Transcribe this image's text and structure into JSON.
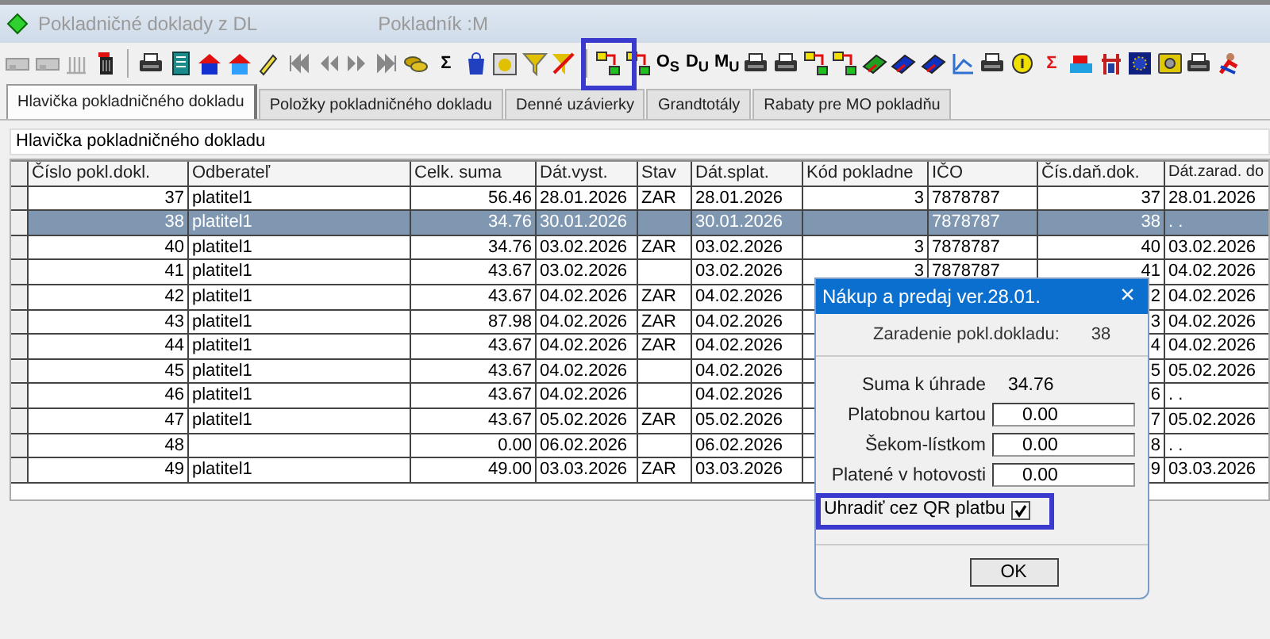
{
  "window": {
    "title": "Pokladničné doklady z DL",
    "cashier": "Pokladník :M"
  },
  "toolbar": [
    {
      "kind": "icon"
    },
    {
      "kind": "icon"
    },
    {
      "kind": "icon"
    },
    {
      "kind": "icon"
    },
    {
      "kind": "separator"
    },
    {
      "kind": "icon"
    },
    {
      "kind": "icon"
    },
    {
      "kind": "icon"
    },
    {
      "kind": "icon"
    },
    {
      "kind": "icon"
    },
    {
      "kind": "icon"
    },
    {
      "kind": "icon"
    },
    {
      "kind": "icon"
    },
    {
      "kind": "icon"
    },
    {
      "kind": "icon"
    },
    {
      "kind": "glyph",
      "text": "Σ",
      "color": "#000000"
    },
    {
      "kind": "icon"
    },
    {
      "kind": "icon"
    },
    {
      "kind": "icon"
    },
    {
      "kind": "icon"
    },
    {
      "kind": "separator"
    },
    {
      "kind": "icon"
    },
    {
      "kind": "icon"
    },
    {
      "kind": "glyph",
      "text": "O$_{S}$",
      "color": "#000000"
    },
    {
      "kind": "glyph",
      "text": "D$_{U}$",
      "color": "#000000"
    },
    {
      "kind": "glyph",
      "text": "M$_{U}$",
      "color": "#000000"
    },
    {
      "kind": "icon"
    },
    {
      "kind": "icon"
    },
    {
      "kind": "icon"
    },
    {
      "kind": "icon"
    },
    {
      "kind": "icon"
    },
    {
      "kind": "icon"
    },
    {
      "kind": "icon"
    },
    {
      "kind": "icon"
    },
    {
      "kind": "icon"
    },
    {
      "kind": "icon"
    },
    {
      "kind": "glyph",
      "text": "Σ",
      "color": "#e01818"
    },
    {
      "kind": "icon"
    },
    {
      "kind": "icon"
    },
    {
      "kind": "icon"
    },
    {
      "kind": "icon"
    },
    {
      "kind": "icon"
    },
    {
      "kind": "icon"
    }
  ],
  "tabs": [
    {
      "label": "Hlavička pokladničného dokladu",
      "selected": true
    },
    {
      "label": "Položky pokladničného dokladu",
      "selected": false
    },
    {
      "label": "Denné uzávierky",
      "selected": false
    },
    {
      "label": "Grandtotály",
      "selected": false
    },
    {
      "label": "Rabaty pre MO pokladňu",
      "selected": false
    }
  ],
  "panel": {
    "title": "Hlavička pokladničného dokladu"
  },
  "table": {
    "columns": [
      "Číslo pokl.dokl.",
      "Odberateľ",
      "Celk. suma",
      "Dát.vyst.",
      "Stav",
      "Dát.splat.",
      "Kód pokladne",
      "IČO",
      "Čís.daň.dok.",
      "Dát.zarad. do"
    ],
    "rows": [
      {
        "selected": false,
        "cells": [
          "37",
          "platitel1",
          "56.46",
          "28.01.2026",
          "ZAR",
          "28.01.2026",
          "3",
          "7878787",
          "37",
          "28.01.2026"
        ]
      },
      {
        "selected": true,
        "cells": [
          "38",
          "platitel1",
          "34.76",
          "30.01.2026",
          null,
          "30.01.2026",
          null,
          "7878787",
          "38",
          ". ."
        ]
      },
      {
        "selected": false,
        "cells": [
          "40",
          "platitel1",
          "34.76",
          "03.02.2026",
          "ZAR",
          "03.02.2026",
          "3",
          "7878787",
          "40",
          "03.02.2026"
        ]
      },
      {
        "selected": false,
        "cells": [
          "41",
          "platitel1",
          "43.67",
          "03.02.2026",
          null,
          "03.02.2026",
          "3",
          "7878787",
          "41",
          "04.02.2026"
        ]
      },
      {
        "selected": false,
        "cells": [
          "42",
          "platitel1",
          "43.67",
          "04.02.2026",
          "ZAR",
          "04.02.2026",
          null,
          null,
          "2",
          "04.02.2026"
        ]
      },
      {
        "selected": false,
        "cells": [
          "43",
          "platitel1",
          "87.98",
          "04.02.2026",
          "ZAR",
          "04.02.2026",
          null,
          null,
          "3",
          "04.02.2026"
        ]
      },
      {
        "selected": false,
        "cells": [
          "44",
          "platitel1",
          "43.67",
          "04.02.2026",
          "ZAR",
          "04.02.2026",
          null,
          null,
          "4",
          "04.02.2026"
        ]
      },
      {
        "selected": false,
        "cells": [
          "45",
          "platitel1",
          "43.67",
          "04.02.2026",
          null,
          "04.02.2026",
          null,
          null,
          "5",
          "05.02.2026"
        ]
      },
      {
        "selected": false,
        "cells": [
          "46",
          "platitel1",
          "43.67",
          "04.02.2026",
          null,
          "04.02.2026",
          null,
          null,
          "6",
          ". ."
        ]
      },
      {
        "selected": false,
        "cells": [
          "47",
          "platitel1",
          "43.67",
          "05.02.2026",
          "ZAR",
          "05.02.2026",
          null,
          null,
          "7",
          "05.02.2026"
        ]
      },
      {
        "selected": false,
        "cells": [
          "48",
          null,
          "0.00",
          "06.02.2026",
          null,
          "06.02.2026",
          null,
          null,
          "8",
          ". ."
        ]
      },
      {
        "selected": false,
        "cells": [
          "49",
          "platitel1",
          "49.00",
          "03.03.2026",
          "ZAR",
          "03.03.2026",
          null,
          null,
          "9",
          "03.03.2026"
        ]
      }
    ]
  },
  "dialog": {
    "title": "Nákup a predaj ver.28.01.",
    "close": "×",
    "header_label": "Zaradenie pokl.dokladu:",
    "header_value": "38",
    "sum_label": "Suma k úhrade",
    "sum_value": "34.76",
    "fields": [
      {
        "label": "Platobnou kartou",
        "value": "0.00"
      },
      {
        "label": "Šekom-lístkom",
        "value": "0.00"
      },
      {
        "label": "Platené v hotovosti",
        "value": "0.00"
      }
    ],
    "qr": {
      "label": "Uhradiť cez QR platbu",
      "checked": true
    },
    "ok": "OK"
  }
}
